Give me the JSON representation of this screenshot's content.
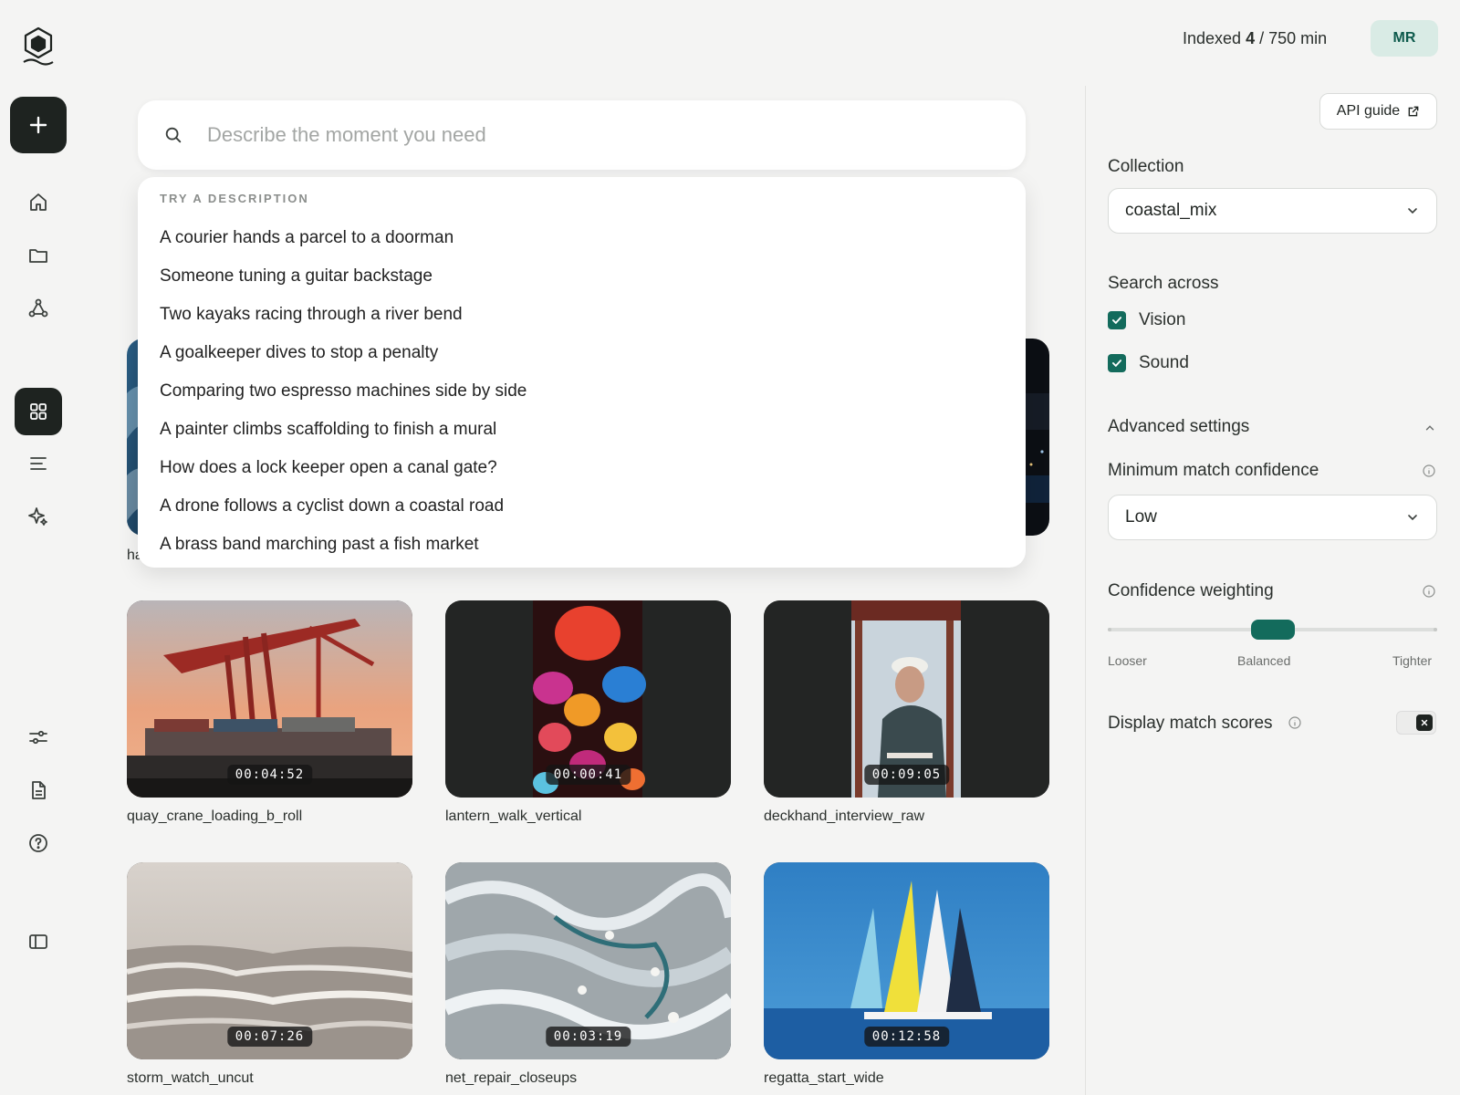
{
  "header": {
    "usage_prefix": "Indexed ",
    "usage_count": "4",
    "usage_suffix": " / 750 min",
    "avatar_initials": "MR"
  },
  "search": {
    "placeholder": "Describe the moment you need"
  },
  "suggestions": {
    "heading": "TRY A DESCRIPTION",
    "items": [
      "A courier hands a parcel to a doorman",
      "Someone tuning a guitar backstage",
      "Two kayaks racing through a river bend",
      "A goalkeeper dives to stop a penalty",
      "Comparing two espresso machines side by side",
      "A painter climbs scaffolding to finish a mural",
      "How does a lock keeper open a canal gate?",
      "A drone follows a cyclist down a coastal road",
      "A brass band marching past a fish market"
    ]
  },
  "partial_card_label": "ha",
  "videos": [
    {
      "title": "quay_crane_loading_b_roll",
      "duration": "00:04:52"
    },
    {
      "title": "lantern_walk_vertical",
      "duration": "00:00:41"
    },
    {
      "title": "deckhand_interview_raw",
      "duration": "00:09:05"
    },
    {
      "title": "storm_watch_uncut",
      "duration": "00:07:26"
    },
    {
      "title": "net_repair_closeups",
      "duration": "00:03:19"
    },
    {
      "title": "regatta_start_wide",
      "duration": "00:12:58"
    }
  ],
  "panel": {
    "api_guide": "API guide",
    "collection_label": "Collection",
    "collection_value": "coastal_mix",
    "search_across_label": "Search across",
    "vision_label": "Vision",
    "sound_label": "Sound",
    "advanced_label": "Advanced settings",
    "min_conf_label": "Minimum match confidence",
    "min_conf_value": "Low",
    "weighting_label": "Confidence weighting",
    "weighting_value": 0.5,
    "slider_left": "Looser",
    "slider_mid": "Balanced",
    "slider_right": "Tighter",
    "display_scores_label": "Display match scores"
  },
  "colors": {
    "accent": "#136b5c",
    "dark": "#1e2320",
    "avatar_bg": "#d9ebe5"
  }
}
